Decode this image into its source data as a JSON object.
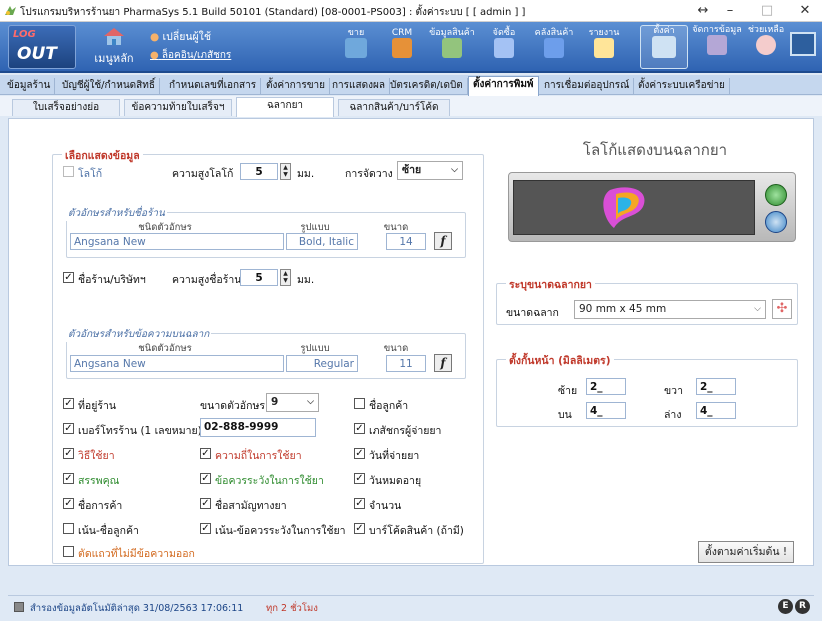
{
  "window": {
    "title": "โปรแกรมบริหารร้านยา PharmaSys 5.1 Build 50101 (Standard) [08-0001-PS003] : ตั้งค่าระบบ [ [ admin ] ]",
    "controls": [
      "↔",
      "–",
      "□",
      "✕"
    ]
  },
  "toolbar": {
    "logout_top": "LOG",
    "logout_bottom": "OUT",
    "main_menu": "เมนูหลัก",
    "change_user": "เปลี่ยนผู้ใช้",
    "login_log": "ล็อคอิน/เภสัชกร",
    "buttons": [
      "ขาย",
      "CRM",
      "ข้อมูลสินค้า",
      "จัดซื้อ",
      "คลังสินค้า",
      "รายงาน",
      "ตั้งค่า",
      "จัดการข้อมูล",
      "ช่วยเหลือ"
    ]
  },
  "menu_tabs": [
    "ข้อมูลร้าน",
    "บัญชีผู้ใช้/กำหนดสิทธิ์",
    "กำหนดเลขที่เอกสาร",
    "ตั้งค่าการขาย",
    "การแสดงผล",
    "บัตรเครดิต/เดบิต",
    "ตั้งค่าการพิมพ์",
    "การเชื่อมต่ออุปกรณ์",
    "ตั้งค่าระบบเครือข่าย"
  ],
  "sub_tabs": [
    "ใบเสร็จอย่างย่อ",
    "ข้อความท้ายใบเสร็จฯ",
    "ฉลากยา",
    "ฉลากสินค้า/บาร์โค้ด"
  ],
  "display": {
    "legend": "เลือกแสดงข้อมูล",
    "logo_label": "โลโก้",
    "logo_height_label": "ความสูงโลโก้",
    "logo_height_value": "5",
    "unit": "มม.",
    "align_label": "การจัดวาง",
    "align_value": "ซ้าย",
    "shop_font_group": "ตัวอักษรสำหรับชื่อร้าน",
    "font_name_hdr": "ชนิดตัวอักษร",
    "font_style_hdr": "รูปแบบ",
    "font_size_hdr": "ขนาด",
    "shop_font_name": "Angsana New",
    "shop_font_style": "Bold, Italic",
    "shop_font_size": "14",
    "shop_name_label": "ชื่อร้าน/บริษัทฯ",
    "shop_name_height_label": "ความสูงชื่อร้าน",
    "shop_name_height_value": "5",
    "label_font_group": "ตัวอักษรสำหรับข้อความบนฉลาก",
    "label_font_name": "Angsana New",
    "label_font_style": "Regular",
    "label_font_size": "11",
    "font_size_label": "ขนาดตัวอักษร",
    "font_size_value": "9",
    "phone_value": "02-888-9999"
  },
  "options": [
    {
      "label": "ที่อยู่ร้าน",
      "checked": true,
      "color": "normal"
    },
    {
      "label": "ชื่อลูกค้า",
      "checked": false,
      "color": "normal"
    },
    {
      "label": "เบอร์โทรร้าน (1 เลขหมาย)",
      "checked": true,
      "color": "normal"
    },
    {
      "label": "เภสัชกรผู้จ่ายยา",
      "checked": true,
      "color": "normal"
    },
    {
      "label": "วิธีใช้ยา",
      "checked": true,
      "color": "red"
    },
    {
      "label": "ความถี่ในการใช้ยา",
      "checked": true,
      "color": "red"
    },
    {
      "label": "วันที่จ่ายยา",
      "checked": true,
      "color": "normal"
    },
    {
      "label": "สรรพคุณ",
      "checked": true,
      "color": "green"
    },
    {
      "label": "ข้อควรระวังในการใช้ยา",
      "checked": true,
      "color": "green"
    },
    {
      "label": "วันหมดอายุ",
      "checked": true,
      "color": "normal"
    },
    {
      "label": "ชื่อการค้า",
      "checked": true,
      "color": "normal"
    },
    {
      "label": "ชื่อสามัญทางยา",
      "checked": true,
      "color": "normal"
    },
    {
      "label": "จำนวน",
      "checked": true,
      "color": "normal"
    },
    {
      "label": "เน้น-ชื่อลูกค้า",
      "checked": false,
      "color": "normal"
    },
    {
      "label": "เน้น-ข้อควรระวังในการใช้ยา",
      "checked": true,
      "color": "normal"
    },
    {
      "label": "บาร์โค้ดสินค้า (ถ้ามี)",
      "checked": true,
      "color": "normal"
    },
    {
      "label": "ตัดแถวที่ไม่มีข้อความออก",
      "checked": false,
      "color": "orange"
    }
  ],
  "logo_panel": {
    "title": "โลโก้แสดงบนฉลากยา"
  },
  "label_size": {
    "legend": "ระบุขนาดฉลากยา",
    "size_label": "ขนาดฉลาก",
    "size_value": "90 mm x 45 mm"
  },
  "margins": {
    "legend": "ตั้งกั้นหน้า (มิลลิเมตร)",
    "left_label": "ซ้าย",
    "left_value": "2_",
    "right_label": "ขวา",
    "right_value": "2_",
    "top_label": "บน",
    "top_value": "4_",
    "bottom_label": "ล่าง",
    "bottom_value": "4_"
  },
  "reset_button": "ตั้งตามค่าเริ่มต้น !",
  "status": {
    "text": "สำรองข้อมูลอัตโนมัติล่าสุด 31/08/2563 17:06:11",
    "ago": "ทุก 2 ชั่วโมง",
    "badges": [
      "E",
      "R"
    ]
  }
}
